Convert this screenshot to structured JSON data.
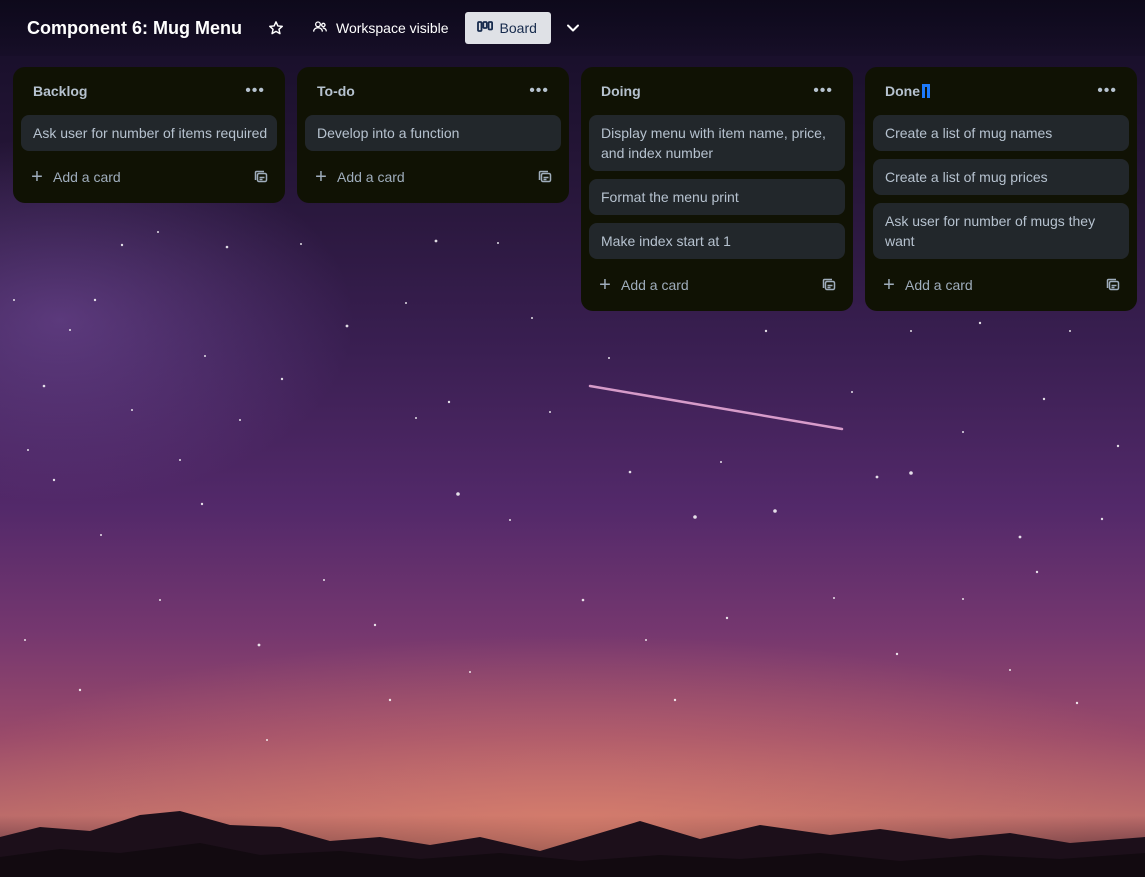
{
  "board": {
    "title": "Component 6: Mug Menu",
    "visibility_label": "Workspace visible",
    "view_label": "Board"
  },
  "lists": [
    {
      "title": "Backlog",
      "cards": [
        "Ask user for number of items required"
      ],
      "add_label": "Add a card"
    },
    {
      "title": "To-do",
      "cards": [
        "Develop into a function"
      ],
      "add_label": "Add a card"
    },
    {
      "title": "Doing",
      "cards": [
        "Display menu with item name, price, and index number",
        "Format the menu print",
        "Make index start at 1"
      ],
      "add_label": "Add a card"
    },
    {
      "title": "Done",
      "cards": [
        "Create a list of mug names",
        "Create a list of mug prices",
        "Ask user for number of mugs they want"
      ],
      "add_label": "Add a card"
    }
  ],
  "icons": {
    "star": "star-icon",
    "visibility": "workspace-visibility-icon",
    "board_view": "board-view-icon",
    "chevron": "chevron-down-icon",
    "list_menu": "more-options-icon",
    "add": "plus-icon",
    "template": "create-from-template-icon"
  },
  "colors": {
    "list_bg": "#101204",
    "card_bg": "#22272b",
    "text": "#b6c2cf",
    "view_button_bg": "#dfe1e6",
    "accent": "#1d7afc"
  }
}
